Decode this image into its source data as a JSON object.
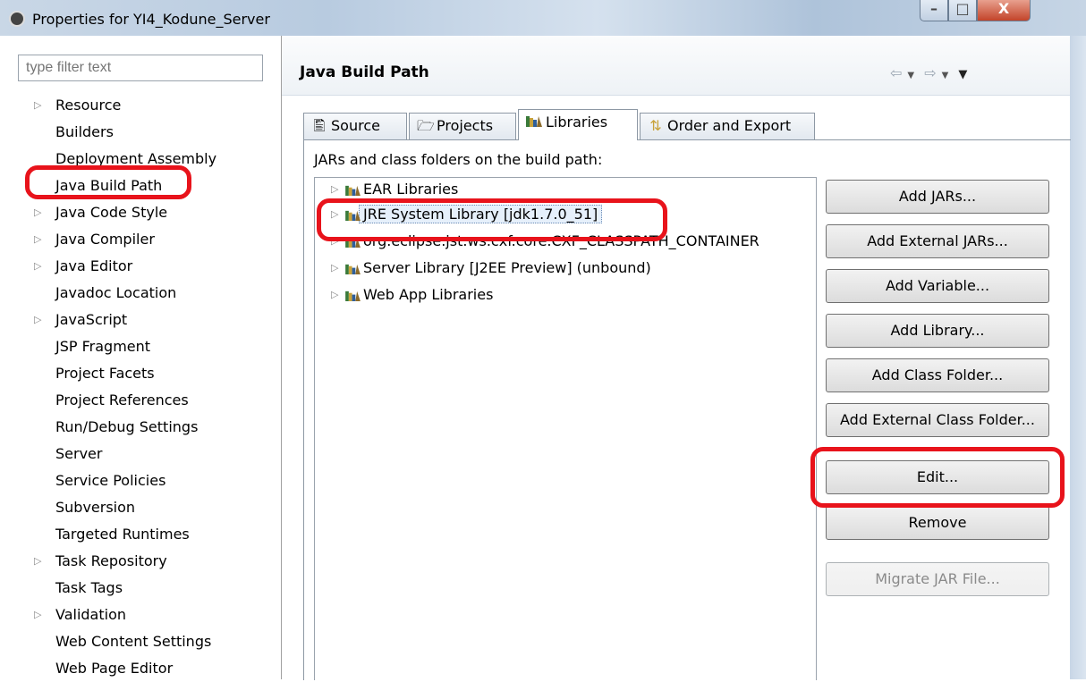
{
  "window": {
    "title": "Properties for YI4_Kodune_Server",
    "minimize": "–",
    "maximize": "□",
    "close": "X"
  },
  "filter": {
    "placeholder": "type filter text"
  },
  "sidebar": {
    "items": [
      {
        "label": "Resource",
        "expandable": true
      },
      {
        "label": "Builders",
        "expandable": false
      },
      {
        "label": "Deployment Assembly",
        "expandable": false
      },
      {
        "label": "Java Build Path",
        "expandable": false,
        "selected": true
      },
      {
        "label": "Java Code Style",
        "expandable": true
      },
      {
        "label": "Java Compiler",
        "expandable": true
      },
      {
        "label": "Java Editor",
        "expandable": true
      },
      {
        "label": "Javadoc Location",
        "expandable": false
      },
      {
        "label": "JavaScript",
        "expandable": true
      },
      {
        "label": "JSP Fragment",
        "expandable": false
      },
      {
        "label": "Project Facets",
        "expandable": false
      },
      {
        "label": "Project References",
        "expandable": false
      },
      {
        "label": "Run/Debug Settings",
        "expandable": false
      },
      {
        "label": "Server",
        "expandable": false
      },
      {
        "label": "Service Policies",
        "expandable": false
      },
      {
        "label": "Subversion",
        "expandable": false
      },
      {
        "label": "Targeted Runtimes",
        "expandable": false
      },
      {
        "label": "Task Repository",
        "expandable": true
      },
      {
        "label": "Task Tags",
        "expandable": false
      },
      {
        "label": "Validation",
        "expandable": true
      },
      {
        "label": "Web Content Settings",
        "expandable": false
      },
      {
        "label": "Web Page Editor",
        "expandable": false
      }
    ]
  },
  "header": {
    "title": "Java Build Path"
  },
  "tabs": [
    {
      "label": "Source",
      "icon": "source-icon"
    },
    {
      "label": "Projects",
      "icon": "folder-icon"
    },
    {
      "label": "Libraries",
      "icon": "library-icon",
      "active": true
    },
    {
      "label": "Order and Export",
      "icon": "order-export-icon"
    }
  ],
  "libraries": {
    "section_label": "JARs and class folders on the build path:",
    "items": [
      {
        "label": "EAR Libraries"
      },
      {
        "label": "JRE System Library [jdk1.7.0_51]",
        "selected": true
      },
      {
        "label": "org.eclipse.jst.ws.cxf.core.CXF_CLASSPATH_CONTAINER"
      },
      {
        "label": "Server Library [J2EE Preview] (unbound)"
      },
      {
        "label": "Web App Libraries"
      }
    ]
  },
  "buttons": {
    "add_jars": "Add JARs...",
    "add_external_jars": "Add External JARs...",
    "add_variable": "Add Variable...",
    "add_library": "Add Library...",
    "add_class_folder": "Add Class Folder...",
    "add_external_class_folder": "Add External Class Folder...",
    "edit": "Edit...",
    "remove": "Remove",
    "migrate_jar": "Migrate JAR File..."
  },
  "colors": {
    "highlight": "#e8131b",
    "selection": "#e6f0fb"
  }
}
